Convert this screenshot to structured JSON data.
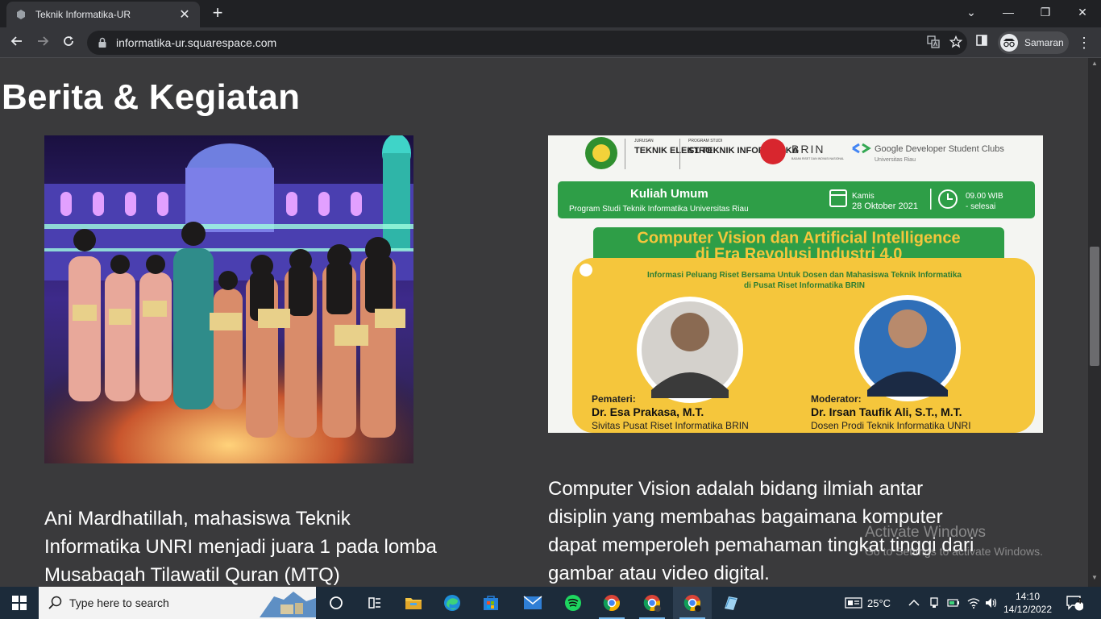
{
  "browser": {
    "tab_title": "Teknik Informatika-UR",
    "tab_close": "✕",
    "new_tab": "+",
    "url": "informatika-ur.squarespace.com",
    "profile_name": "Samaran",
    "window_controls": {
      "chevron": "⌄",
      "minimize": "—",
      "restore": "❐",
      "close": "✕"
    }
  },
  "page": {
    "heading": "Berita & Kegiatan",
    "article1": {
      "caption": "Ani Mardhatillah, mahasiswa Teknik Informatika UNRI menjadi juara 1 pada lomba Musabaqah Tilawatil Quran (MTQ)"
    },
    "article2": {
      "caption": "Computer Vision adalah bidang ilmiah antar disiplin yang membahas bagaimana komputer dapat memperoleh pemahaman tingkat tinggi dari gambar atau video digital.",
      "poster": {
        "dept1_small": "JURUSAN",
        "dept1": "TEKNIK ELEKTRO",
        "dept2_small": "PROGRAM STUDI",
        "dept2": "S1 TEKNIK INFORMATIKA",
        "brin": "BRIN",
        "brin_sub": "BADAN RISET DAN INOVASI NASIONAL",
        "gdsc": "Google Developer Student Clubs",
        "gdsc_sub": "Universitas Riau",
        "event_type": "Kuliah Umum",
        "event_org": "Program Studi Teknik Informatika Universitas Riau",
        "day": "Kamis",
        "date": "28 Oktober 2021",
        "time": "09.00 WIB",
        "time_end": "- selesai",
        "title_line1": "Computer Vision dan Artificial Intelligence",
        "title_line2": "di Era Revolusi Industri 4.0",
        "subtitle_line1": "Informasi Peluang Riset Bersama Untuk Dosen dan Mahasiswa Teknik Informatika",
        "subtitle_line2": "di Pusat Riset Informatika BRIN",
        "speaker_role": "Pemateri:",
        "speaker_name": "Dr. Esa Prakasa, M.T.",
        "speaker_affil": "Sivitas Pusat Riset Informatika BRIN",
        "moderator_role": "Moderator:",
        "moderator_name": "Dr. Irsan Taufik Ali, S.T., M.T.",
        "moderator_affil": "Dosen Prodi Teknik Informatika UNRI"
      }
    }
  },
  "watermark": {
    "line1": "Activate Windows",
    "line2": "Go to Settings to activate Windows."
  },
  "taskbar": {
    "search_placeholder": "Type here to search",
    "temperature": "25°C",
    "time": "14:10",
    "date": "14/12/2022",
    "notifications": "4"
  },
  "colors": {
    "page_bg": "#3a3a3c",
    "poster_green": "#2e9e47",
    "poster_yellow": "#f5c63c"
  }
}
